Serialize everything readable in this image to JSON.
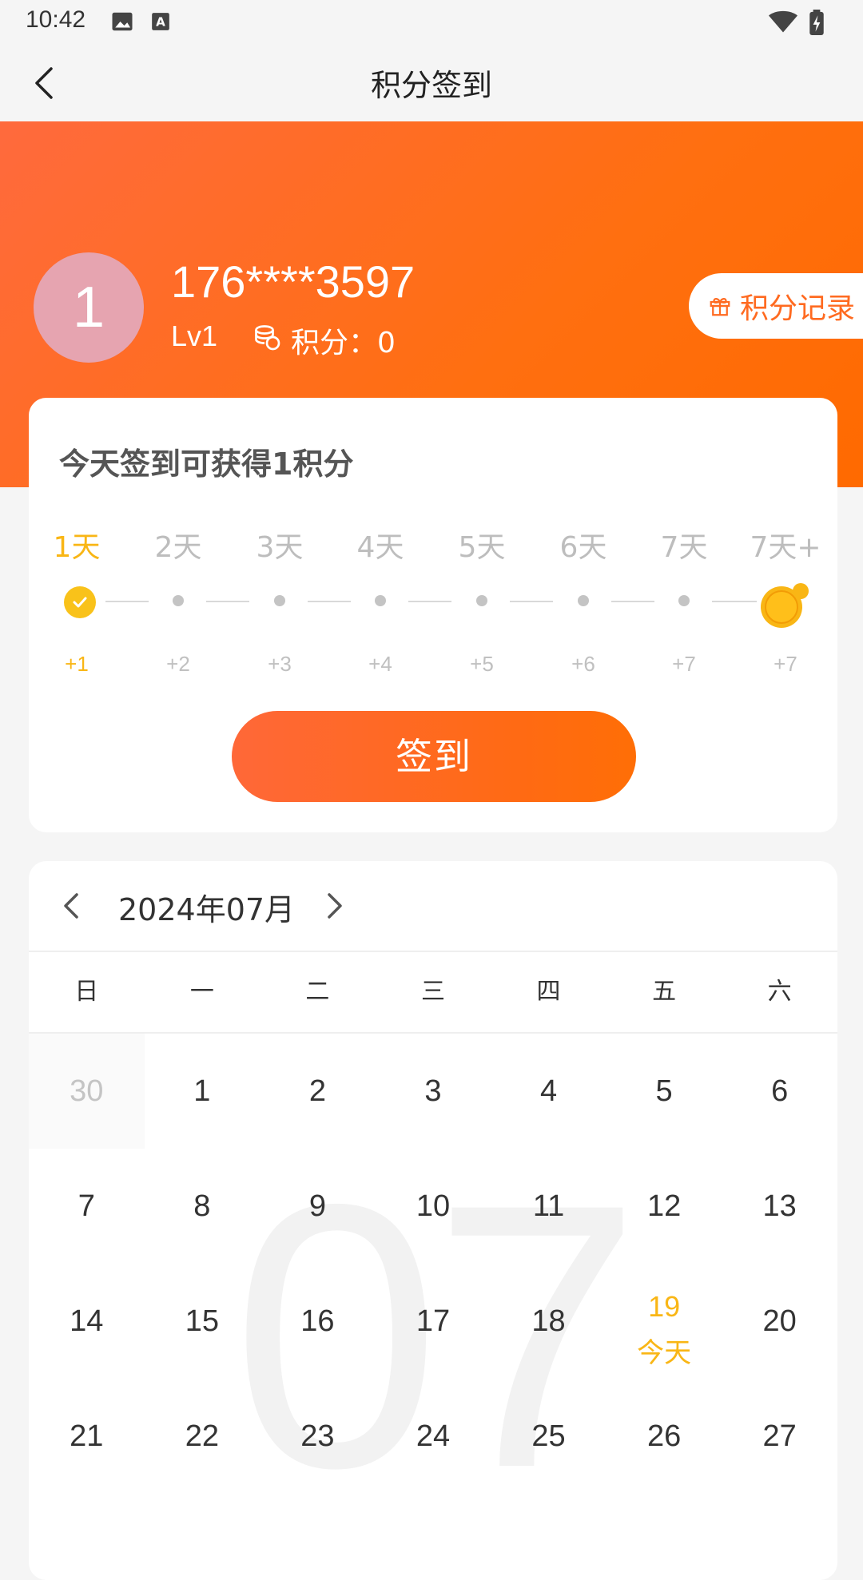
{
  "status_bar": {
    "time": "10:42"
  },
  "nav": {
    "title": "积分签到"
  },
  "profile": {
    "avatar_text": "1",
    "phone": "176****3597",
    "level": "Lv1",
    "points": "积分：0",
    "record_button": "积分记录"
  },
  "signin": {
    "title": "今天签到可获得1积分",
    "days": [
      "1天",
      "2天",
      "3天",
      "4天",
      "5天",
      "6天",
      "7天",
      "7天+"
    ],
    "bonuses": [
      "+1",
      "+2",
      "+3",
      "+4",
      "+5",
      "+6",
      "+7",
      "+7"
    ],
    "button": "签到"
  },
  "calendar": {
    "month": "2024年07月",
    "watermark": "07",
    "weekdays": [
      "日",
      "一",
      "二",
      "三",
      "四",
      "五",
      "六"
    ],
    "dates": [
      [
        "30",
        "1",
        "2",
        "3",
        "4",
        "5",
        "6"
      ],
      [
        "7",
        "8",
        "9",
        "10",
        "11",
        "12",
        "13"
      ],
      [
        "14",
        "15",
        "16",
        "17",
        "18",
        "19",
        "20"
      ],
      [
        "21",
        "22",
        "23",
        "24",
        "25",
        "26",
        "27"
      ]
    ],
    "today_label": "今天"
  },
  "colors": {
    "brand_orange": "#ff6a20",
    "accent_yellow": "#f9b615"
  }
}
